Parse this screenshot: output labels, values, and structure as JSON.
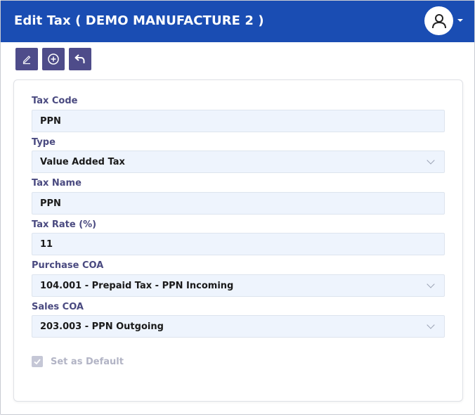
{
  "header": {
    "title": "Edit Tax ( DEMO MANUFACTURE 2 )",
    "user_icon": "user-avatar-icon",
    "bg_color": "#1a4db3"
  },
  "toolbar": {
    "buttons": [
      {
        "icon": "edit-icon"
      },
      {
        "icon": "add-circle-icon"
      },
      {
        "icon": "undo-icon"
      }
    ],
    "button_color": "#4e4c8a"
  },
  "form": {
    "tax_code": {
      "label": "Tax Code",
      "value": "PPN"
    },
    "type": {
      "label": "Type",
      "value": "Value Added Tax"
    },
    "tax_name": {
      "label": "Tax Name",
      "value": "PPN"
    },
    "tax_rate": {
      "label": "Tax Rate (%)",
      "value": "11"
    },
    "purchase_coa": {
      "label": "Purchase COA",
      "value": "104.001 - Prepaid Tax - PPN Incoming"
    },
    "sales_coa": {
      "label": "Sales COA",
      "value": "203.003 - PPN Outgoing"
    },
    "set_default": {
      "label": "Set as Default",
      "checked": true,
      "disabled": true
    }
  }
}
